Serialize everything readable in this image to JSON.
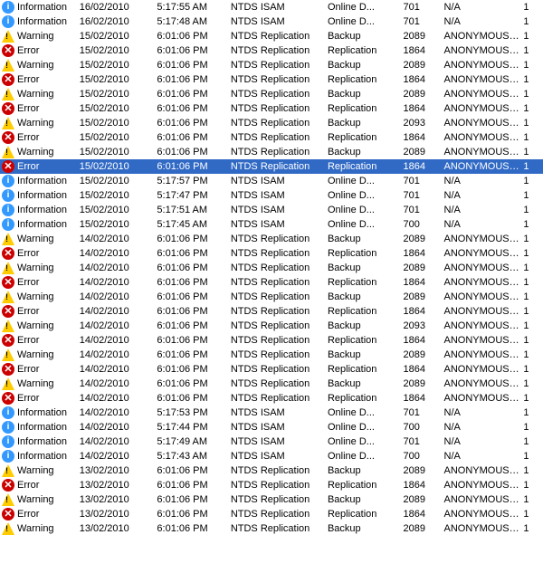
{
  "colors": {
    "selected_bg": "#316AC5",
    "selected_text": "#ffffff",
    "odd_bg": "#ffffff",
    "even_bg": "#f0f0f0",
    "warn_color": "#ffcc00",
    "error_color": "#cc0000",
    "info_color": "#3399ff"
  },
  "rows": [
    {
      "type": "Information",
      "date": "16/02/2010",
      "time": "5:17:55 AM",
      "source": "NTDS ISAM",
      "category": "Online D...",
      "event": "701",
      "user": "N/A",
      "num": "1",
      "selected": false
    },
    {
      "type": "Information",
      "date": "16/02/2010",
      "time": "5:17:48 AM",
      "source": "NTDS ISAM",
      "category": "Online D...",
      "event": "701",
      "user": "N/A",
      "num": "1",
      "selected": false
    },
    {
      "type": "Warning",
      "date": "15/02/2010",
      "time": "6:01:06 PM",
      "source": "NTDS Replication",
      "category": "Backup",
      "event": "2089",
      "user": "ANONYMOUS L...",
      "num": "1",
      "selected": false
    },
    {
      "type": "Error",
      "date": "15/02/2010",
      "time": "6:01:06 PM",
      "source": "NTDS Replication",
      "category": "Replication",
      "event": "1864",
      "user": "ANONYMOUS L...",
      "num": "1",
      "selected": false
    },
    {
      "type": "Warning",
      "date": "15/02/2010",
      "time": "6:01:06 PM",
      "source": "NTDS Replication",
      "category": "Backup",
      "event": "2089",
      "user": "ANONYMOUS L...",
      "num": "1",
      "selected": false
    },
    {
      "type": "Error",
      "date": "15/02/2010",
      "time": "6:01:06 PM",
      "source": "NTDS Replication",
      "category": "Replication",
      "event": "1864",
      "user": "ANONYMOUS L...",
      "num": "1",
      "selected": false
    },
    {
      "type": "Warning",
      "date": "15/02/2010",
      "time": "6:01:06 PM",
      "source": "NTDS Replication",
      "category": "Backup",
      "event": "2089",
      "user": "ANONYMOUS L...",
      "num": "1",
      "selected": false
    },
    {
      "type": "Error",
      "date": "15/02/2010",
      "time": "6:01:06 PM",
      "source": "NTDS Replication",
      "category": "Replication",
      "event": "1864",
      "user": "ANONYMOUS L...",
      "num": "1",
      "selected": false
    },
    {
      "type": "Warning",
      "date": "15/02/2010",
      "time": "6:01:06 PM",
      "source": "NTDS Replication",
      "category": "Backup",
      "event": "2093",
      "user": "ANONYMOUS L...",
      "num": "1",
      "selected": false
    },
    {
      "type": "Error",
      "date": "15/02/2010",
      "time": "6:01:06 PM",
      "source": "NTDS Replication",
      "category": "Replication",
      "event": "1864",
      "user": "ANONYMOUS L...",
      "num": "1",
      "selected": false
    },
    {
      "type": "Warning",
      "date": "15/02/2010",
      "time": "6:01:06 PM",
      "source": "NTDS Replication",
      "category": "Backup",
      "event": "2089",
      "user": "ANONYMOUS L...",
      "num": "1",
      "selected": false
    },
    {
      "type": "Error",
      "date": "15/02/2010",
      "time": "6:01:06 PM",
      "source": "NTDS Replication",
      "category": "Replication",
      "event": "1864",
      "user": "ANONYMOUS L...",
      "num": "1",
      "selected": true
    },
    {
      "type": "Information",
      "date": "15/02/2010",
      "time": "5:17:57 PM",
      "source": "NTDS ISAM",
      "category": "Online D...",
      "event": "701",
      "user": "N/A",
      "num": "1",
      "selected": false
    },
    {
      "type": "Information",
      "date": "15/02/2010",
      "time": "5:17:47 PM",
      "source": "NTDS ISAM",
      "category": "Online D...",
      "event": "701",
      "user": "N/A",
      "num": "1",
      "selected": false
    },
    {
      "type": "Information",
      "date": "15/02/2010",
      "time": "5:17:51 AM",
      "source": "NTDS ISAM",
      "category": "Online D...",
      "event": "701",
      "user": "N/A",
      "num": "1",
      "selected": false
    },
    {
      "type": "Information",
      "date": "15/02/2010",
      "time": "5:17:45 AM",
      "source": "NTDS ISAM",
      "category": "Online D...",
      "event": "700",
      "user": "N/A",
      "num": "1",
      "selected": false
    },
    {
      "type": "Warning",
      "date": "14/02/2010",
      "time": "6:01:06 PM",
      "source": "NTDS Replication",
      "category": "Backup",
      "event": "2089",
      "user": "ANONYMOUS L...",
      "num": "1",
      "selected": false
    },
    {
      "type": "Error",
      "date": "14/02/2010",
      "time": "6:01:06 PM",
      "source": "NTDS Replication",
      "category": "Replication",
      "event": "1864",
      "user": "ANONYMOUS L...",
      "num": "1",
      "selected": false
    },
    {
      "type": "Warning",
      "date": "14/02/2010",
      "time": "6:01:06 PM",
      "source": "NTDS Replication",
      "category": "Backup",
      "event": "2089",
      "user": "ANONYMOUS L...",
      "num": "1",
      "selected": false
    },
    {
      "type": "Error",
      "date": "14/02/2010",
      "time": "6:01:06 PM",
      "source": "NTDS Replication",
      "category": "Replication",
      "event": "1864",
      "user": "ANONYMOUS L...",
      "num": "1",
      "selected": false
    },
    {
      "type": "Warning",
      "date": "14/02/2010",
      "time": "6:01:06 PM",
      "source": "NTDS Replication",
      "category": "Backup",
      "event": "2089",
      "user": "ANONYMOUS L...",
      "num": "1",
      "selected": false
    },
    {
      "type": "Error",
      "date": "14/02/2010",
      "time": "6:01:06 PM",
      "source": "NTDS Replication",
      "category": "Replication",
      "event": "1864",
      "user": "ANONYMOUS L...",
      "num": "1",
      "selected": false
    },
    {
      "type": "Warning",
      "date": "14/02/2010",
      "time": "6:01:06 PM",
      "source": "NTDS Replication",
      "category": "Backup",
      "event": "2093",
      "user": "ANONYMOUS L...",
      "num": "1",
      "selected": false
    },
    {
      "type": "Error",
      "date": "14/02/2010",
      "time": "6:01:06 PM",
      "source": "NTDS Replication",
      "category": "Replication",
      "event": "1864",
      "user": "ANONYMOUS L...",
      "num": "1",
      "selected": false
    },
    {
      "type": "Warning",
      "date": "14/02/2010",
      "time": "6:01:06 PM",
      "source": "NTDS Replication",
      "category": "Backup",
      "event": "2089",
      "user": "ANONYMOUS L...",
      "num": "1",
      "selected": false
    },
    {
      "type": "Error",
      "date": "14/02/2010",
      "time": "6:01:06 PM",
      "source": "NTDS Replication",
      "category": "Replication",
      "event": "1864",
      "user": "ANONYMOUS L...",
      "num": "1",
      "selected": false
    },
    {
      "type": "Warning",
      "date": "14/02/2010",
      "time": "6:01:06 PM",
      "source": "NTDS Replication",
      "category": "Backup",
      "event": "2089",
      "user": "ANONYMOUS L...",
      "num": "1",
      "selected": false
    },
    {
      "type": "Error",
      "date": "14/02/2010",
      "time": "6:01:06 PM",
      "source": "NTDS Replication",
      "category": "Replication",
      "event": "1864",
      "user": "ANONYMOUS L...",
      "num": "1",
      "selected": false
    },
    {
      "type": "Information",
      "date": "14/02/2010",
      "time": "5:17:53 PM",
      "source": "NTDS ISAM",
      "category": "Online D...",
      "event": "701",
      "user": "N/A",
      "num": "1",
      "selected": false
    },
    {
      "type": "Information",
      "date": "14/02/2010",
      "time": "5:17:44 PM",
      "source": "NTDS ISAM",
      "category": "Online D...",
      "event": "700",
      "user": "N/A",
      "num": "1",
      "selected": false
    },
    {
      "type": "Information",
      "date": "14/02/2010",
      "time": "5:17:49 AM",
      "source": "NTDS ISAM",
      "category": "Online D...",
      "event": "701",
      "user": "N/A",
      "num": "1",
      "selected": false
    },
    {
      "type": "Information",
      "date": "14/02/2010",
      "time": "5:17:43 AM",
      "source": "NTDS ISAM",
      "category": "Online D...",
      "event": "700",
      "user": "N/A",
      "num": "1",
      "selected": false
    },
    {
      "type": "Warning",
      "date": "13/02/2010",
      "time": "6:01:06 PM",
      "source": "NTDS Replication",
      "category": "Backup",
      "event": "2089",
      "user": "ANONYMOUS L...",
      "num": "1",
      "selected": false
    },
    {
      "type": "Error",
      "date": "13/02/2010",
      "time": "6:01:06 PM",
      "source": "NTDS Replication",
      "category": "Replication",
      "event": "1864",
      "user": "ANONYMOUS L...",
      "num": "1",
      "selected": false
    },
    {
      "type": "Warning",
      "date": "13/02/2010",
      "time": "6:01:06 PM",
      "source": "NTDS Replication",
      "category": "Backup",
      "event": "2089",
      "user": "ANONYMOUS L...",
      "num": "1",
      "selected": false
    },
    {
      "type": "Error",
      "date": "13/02/2010",
      "time": "6:01:06 PM",
      "source": "NTDS Replication",
      "category": "Replication",
      "event": "1864",
      "user": "ANONYMOUS L...",
      "num": "1",
      "selected": false
    },
    {
      "type": "Warning",
      "date": "13/02/2010",
      "time": "6:01:06 PM",
      "source": "NTDS Replication",
      "category": "Backup",
      "event": "2089",
      "user": "ANONYMOUS L...",
      "num": "1",
      "selected": false
    }
  ]
}
